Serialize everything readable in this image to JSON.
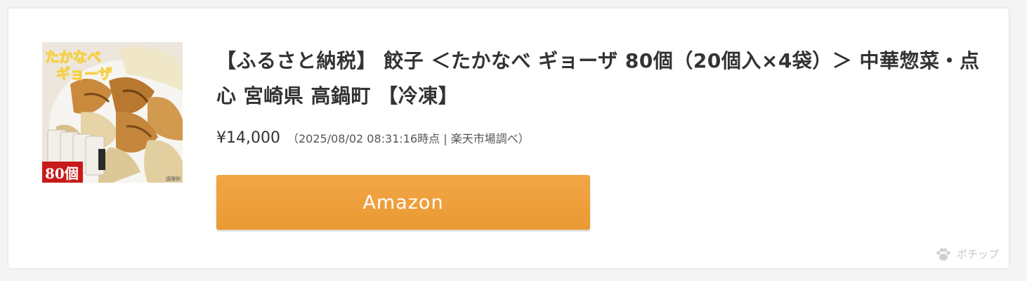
{
  "product": {
    "title": "【ふるさと納税】 餃子 ＜たかなべ ギョーザ 80個（20個入×4袋）＞ 中華惣菜・点心 宮崎県 高鍋町 【冷凍】",
    "price": "¥14,000",
    "price_note": "（2025/08/02 08:31:16時点 | 楽天市場調べ）",
    "image": {
      "logo_text_line1": "たかなべ",
      "logo_text_line2": "ギョーザ",
      "badge_text": "80個",
      "corner_text": "調理例"
    }
  },
  "buttons": {
    "amazon_label": "Amazon"
  },
  "credit": {
    "label": "ポチップ",
    "icon": "paw-icon"
  },
  "colors": {
    "button": "#ef9f3c",
    "title": "#333333",
    "credit": "#c6c6c6"
  }
}
